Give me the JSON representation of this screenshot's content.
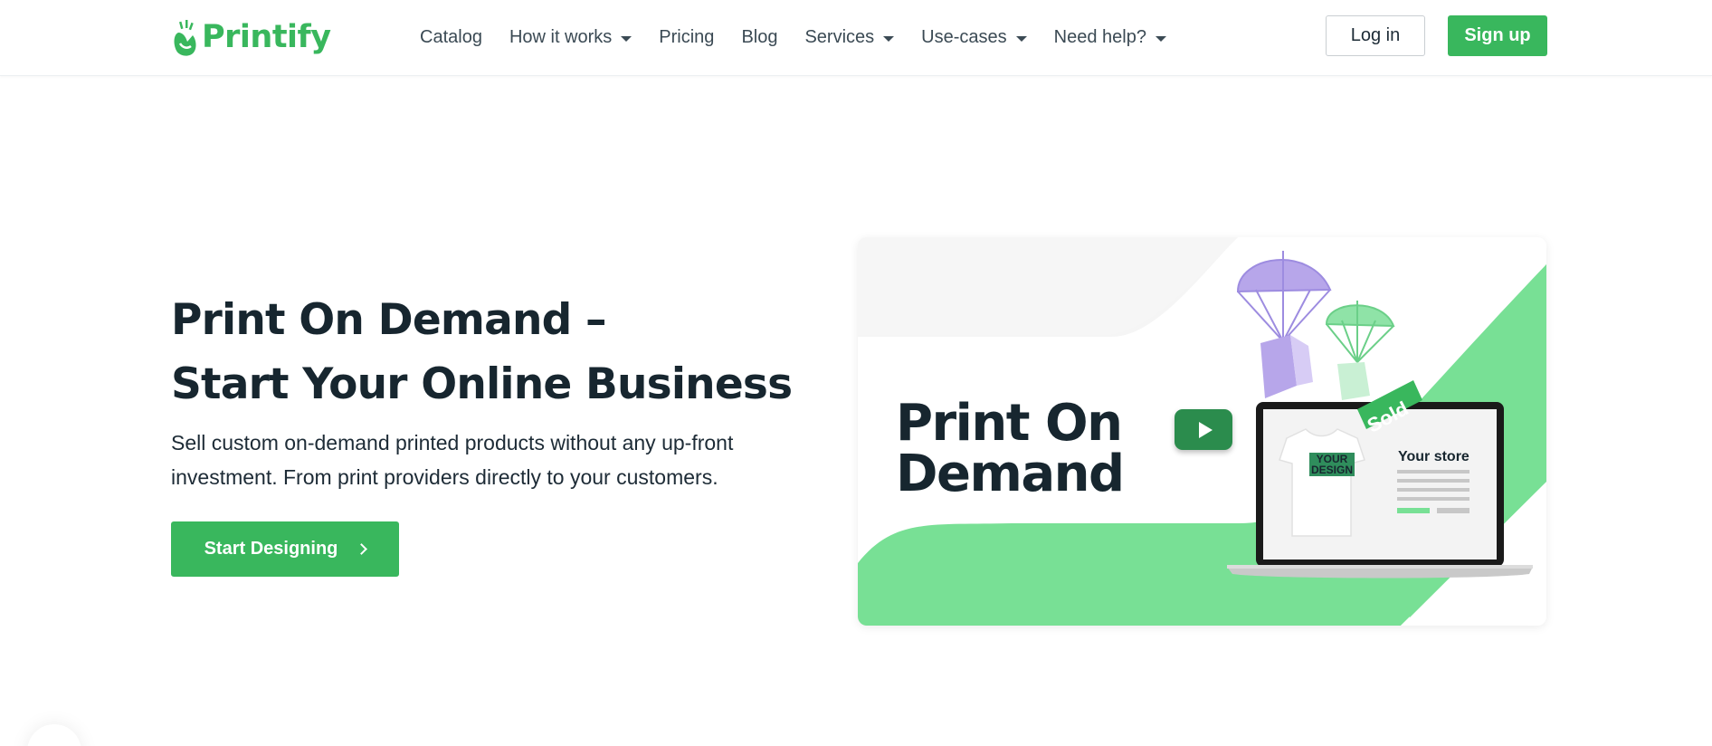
{
  "brand": {
    "name": "Printify",
    "color": "#39b75d"
  },
  "nav": {
    "items": [
      {
        "label": "Catalog",
        "dropdown": false
      },
      {
        "label": "How it works",
        "dropdown": true
      },
      {
        "label": "Pricing",
        "dropdown": false
      },
      {
        "label": "Blog",
        "dropdown": false
      },
      {
        "label": "Services",
        "dropdown": true
      },
      {
        "label": "Use-cases",
        "dropdown": true
      },
      {
        "label": "Need help?",
        "dropdown": true
      }
    ]
  },
  "auth": {
    "login_label": "Log in",
    "signup_label": "Sign up"
  },
  "hero": {
    "title_line1": "Print On Demand –",
    "title_line2": "Start Your Online Business",
    "subtitle": "Sell custom on-demand printed products without any up-front investment. From print providers directly to your customers.",
    "cta_label": "Start Designing"
  },
  "video": {
    "title": "Print On Demand",
    "store_label": "Your store",
    "sold_label": "Sold",
    "shirt_text_line1": "YOUR",
    "shirt_text_line2": "DESIGN",
    "icons": [
      "play-icon",
      "parachute-icon",
      "laptop-icon",
      "tshirt-icon"
    ]
  }
}
